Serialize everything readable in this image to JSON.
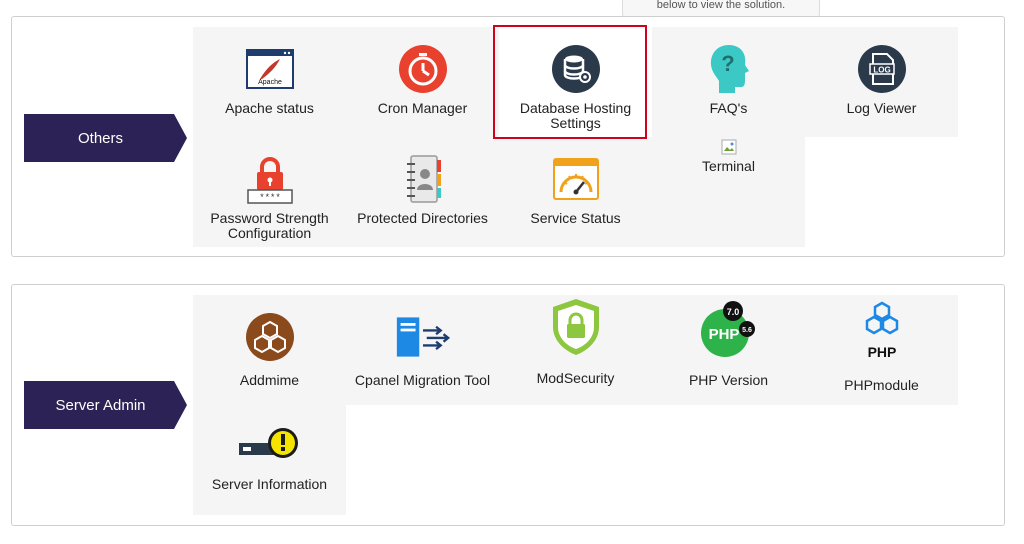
{
  "tooltip": {
    "text": "below to view the solution."
  },
  "sections": {
    "others": {
      "label": "Others",
      "items": [
        {
          "label": "Apache status",
          "icon": "apache-icon"
        },
        {
          "label": "Cron Manager",
          "icon": "stopwatch-icon"
        },
        {
          "label": "Database Hosting\nSettings",
          "icon": "database-settings-icon",
          "highlighted": true
        },
        {
          "label": "FAQ's",
          "icon": "question-head-icon"
        },
        {
          "label": "Log Viewer",
          "icon": "log-icon"
        },
        {
          "label": "Password Strength\nConfiguration",
          "icon": "lock-password-icon"
        },
        {
          "label": "Protected Directories",
          "icon": "address-book-icon"
        },
        {
          "label": "Service Status",
          "icon": "gauge-icon"
        },
        {
          "label": "Terminal",
          "icon": "broken-image-icon"
        }
      ]
    },
    "server_admin": {
      "label": "Server Admin",
      "items": [
        {
          "label": "Addmime",
          "icon": "cubes-icon"
        },
        {
          "label": "Cpanel Migration Tool",
          "icon": "server-migrate-icon"
        },
        {
          "label": "ModSecurity",
          "icon": "shield-lock-icon"
        },
        {
          "label": "PHP Version",
          "icon": "php-version-icon"
        },
        {
          "label": "PHPmodule",
          "icon": "php-module-icon"
        },
        {
          "label": "Server Information",
          "icon": "server-warning-icon"
        }
      ]
    }
  },
  "icon_text": {
    "apache": "Apache",
    "log": "LOG",
    "password": "****",
    "php": "PHP",
    "php7": "7.0",
    "php56": "5.6"
  },
  "colors": {
    "tag_bg": "#2d2255",
    "highlight": "#d0021b",
    "red_icon": "#e8412d",
    "dark_icon": "#2b3a4a",
    "teal": "#3cc9c6",
    "orange": "#f1a21c",
    "brown": "#8a4a1c",
    "green": "#8dc63f",
    "blue": "#1e88e5"
  }
}
